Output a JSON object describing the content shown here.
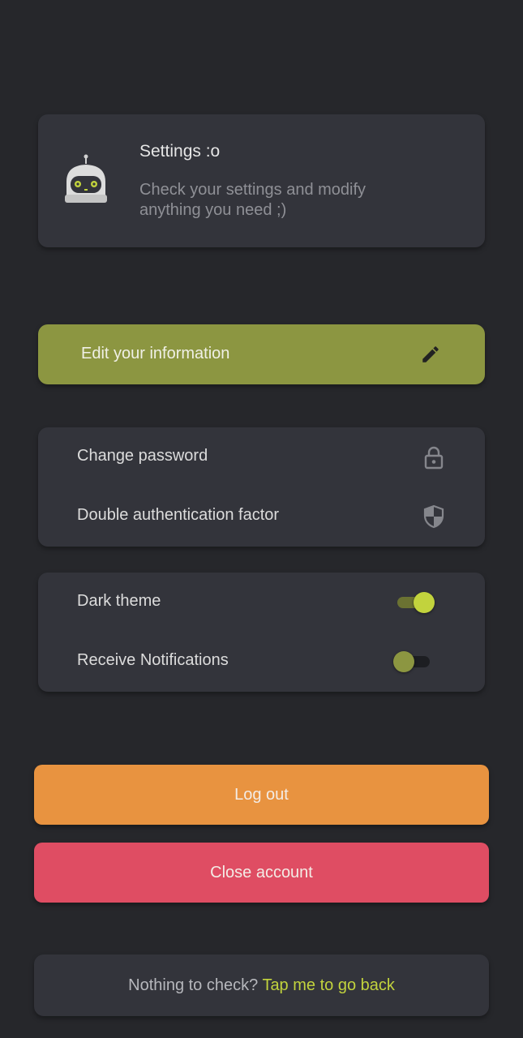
{
  "header": {
    "title": "Settings :o",
    "subtitle": "Check your settings and modify anything you need ;)",
    "icon": "robot-icon"
  },
  "edit_info": {
    "label": "Edit your information",
    "icon": "pencil-icon"
  },
  "security": {
    "items": [
      {
        "label": "Change password",
        "icon": "lock-icon"
      },
      {
        "label": "Double authentication factor",
        "icon": "shield-icon"
      }
    ]
  },
  "preferences": {
    "items": [
      {
        "label": "Dark theme",
        "enabled": true
      },
      {
        "label": "Receive Notifications",
        "enabled": false
      }
    ]
  },
  "actions": {
    "logout_label": "Log out",
    "close_account_label": "Close account"
  },
  "footer": {
    "text": "Nothing to check?",
    "link": "Tap me to go back"
  },
  "colors": {
    "background": "#26272b",
    "card": "#33343b",
    "accent": "#8c9641",
    "accent_bright": "#c2d33d",
    "logout": "#e89340",
    "close_account": "#df4d63"
  }
}
